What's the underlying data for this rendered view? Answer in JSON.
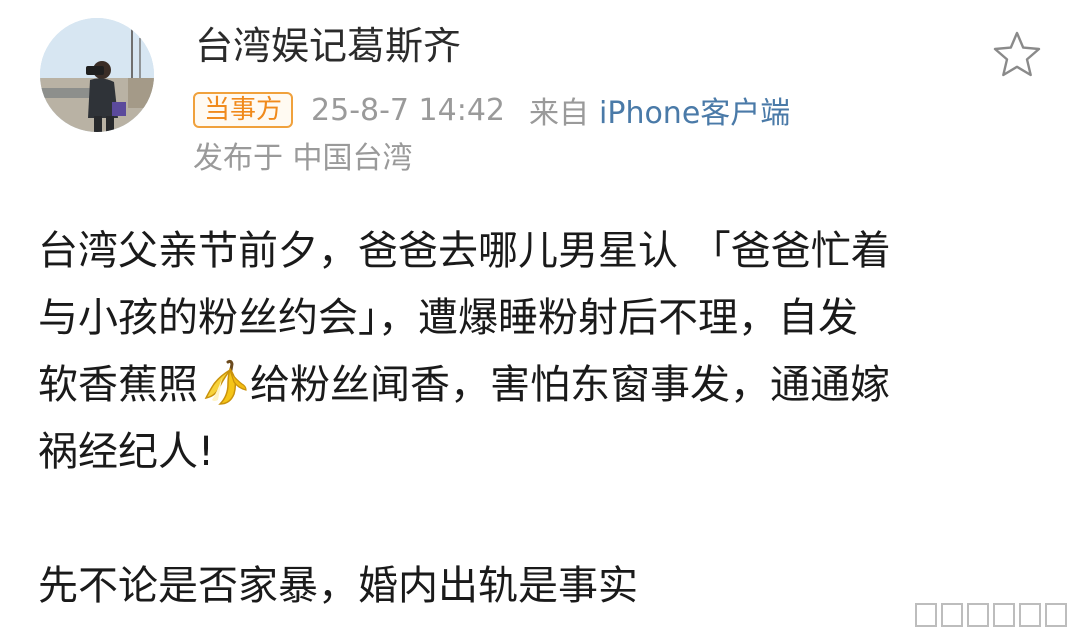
{
  "post": {
    "author": {
      "name": "台湾娱记葛斯齐"
    },
    "badge": "当事方",
    "time": "25-8-7 14:42",
    "source_prefix": "来自",
    "source_client": "iPhone客户端",
    "location": "发布于 中国台湾",
    "content": {
      "line1": "台湾父亲节前夕，爸爸去哪儿男星认 「爸爸忙着",
      "line2": "与小孩的粉丝约会」，遭爆睡粉射后不理，自发",
      "line3_before": "软香蕉照",
      "line3_emoji": "banana-emoji",
      "line3_after": "给粉丝闻香，害怕东窗事发，通通嫁",
      "line4": "祸经纪人!",
      "line5": "先不论是否家暴，婚内出轨是事实"
    }
  },
  "icons": {
    "favorite": "star-outline-icon",
    "watermark": "weibo-watermark-icon"
  },
  "colors": {
    "badge_border": "#f0a13c",
    "badge_text": "#f08a1c",
    "meta_gray": "#9a9a9a",
    "link_blue": "#4a7aa8",
    "text": "#1a1a1a"
  }
}
